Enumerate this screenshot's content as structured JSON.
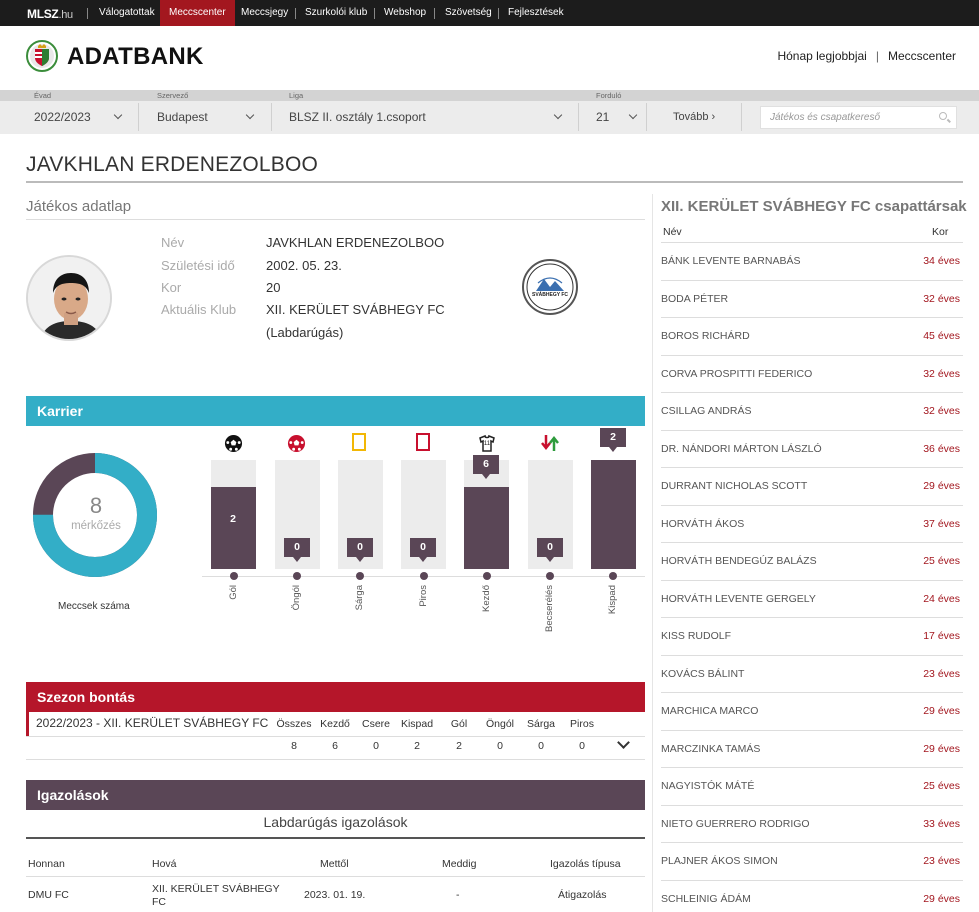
{
  "topnav": {
    "logo_main": "MLSZ",
    "logo_suffix": ".hu",
    "items": [
      "Válogatottak",
      "Meccscenter",
      "Meccsjegy",
      "Szurkolói klub",
      "Webshop",
      "Szövetség",
      "Fejlesztések"
    ],
    "active": "Meccscenter"
  },
  "header": {
    "brand": "ADATBANK",
    "links": [
      "Hónap legjobbjai",
      "Meccscenter"
    ]
  },
  "filters": {
    "season_label": "Évad",
    "season_value": "2022/2023",
    "organizer_label": "Szervező",
    "organizer_value": "Budapest",
    "league_label": "Liga",
    "league_value": "BLSZ II. osztály 1.csoport",
    "round_label": "Forduló",
    "round_value": "21",
    "next_label": "Tovább",
    "search_placeholder": "Játékos és csapatkereső"
  },
  "player": {
    "name": "JAVKHLAN ERDENEZOLBOO",
    "section_title": "Játékos adatlap",
    "fields": [
      {
        "label": "Név",
        "value": "JAVKHLAN ERDENEZOLBOO"
      },
      {
        "label": "Születési idő",
        "value": "2002. 05. 23."
      },
      {
        "label": "Kor",
        "value": "20"
      },
      {
        "label": "Aktuális Klub",
        "value": "XII. KERÜLET SVÁBHEGY FC"
      }
    ],
    "club_sport": "(Labdarúgás)",
    "club_logo_text": "SVÁBHEGY FC"
  },
  "career": {
    "title": "Karrier",
    "matches_count": "8",
    "matches_unit": "mérkőzés",
    "donut_caption": "Meccsek száma",
    "donut_fraction": 0.75,
    "stats": [
      {
        "label": "Gól",
        "value": 2,
        "icon": "ball-icon"
      },
      {
        "label": "Öngól",
        "value": 0,
        "icon": "own-goal-ball-icon"
      },
      {
        "label": "Sárga",
        "value": 0,
        "icon": "yellow-card-icon"
      },
      {
        "label": "Piros",
        "value": 0,
        "icon": "red-card-icon"
      },
      {
        "label": "Kezdő",
        "value": 6,
        "icon": "starting-jersey-icon"
      },
      {
        "label": "Becserélés",
        "value": 0,
        "icon": "substitution-arrows-icon"
      },
      {
        "label": "Kispad",
        "value": 2,
        "icon": "bench-icon"
      }
    ],
    "colors": {
      "accent": "#33aec7",
      "bar": "#5a4656",
      "goal_icon": "#111111",
      "owngoal_icon": "#c8102e",
      "yellow": "#f2b705",
      "red": "#c8102e"
    }
  },
  "season": {
    "title": "Szezon bontás",
    "name": "2022/2023 - XII. KERÜLET SVÁBHEGY FC",
    "headers": [
      "Összes",
      "Kezdő",
      "Csere",
      "Kispad",
      "Gól",
      "Öngól",
      "Sárga",
      "Piros"
    ],
    "values": [
      "8",
      "6",
      "0",
      "2",
      "2",
      "0",
      "0",
      "0"
    ]
  },
  "registrations": {
    "title": "Igazolások",
    "subtitle": "Labdarúgás igazolások",
    "headers": [
      "Honnan",
      "Hová",
      "Mettől",
      "Meddig",
      "Igazolás típusa"
    ],
    "rows": [
      {
        "from": "DMU FC",
        "to": "XII. KERÜLET SVÁBHEGY FC",
        "since": "2023. 01. 19.",
        "until": "-",
        "type": "Átigazolás"
      }
    ]
  },
  "teammates": {
    "title": "XII. KERÜLET SVÁBHEGY FC csapattársak",
    "col_name": "Név",
    "col_age": "Kor",
    "list": [
      {
        "name": "BÁNK LEVENTE BARNABÁS",
        "age": "34 éves"
      },
      {
        "name": "BODA PÉTER",
        "age": "32 éves"
      },
      {
        "name": "BOROS RICHÁRD",
        "age": "45 éves"
      },
      {
        "name": "CORVA PROSPITTI FEDERICO",
        "age": "32 éves"
      },
      {
        "name": "CSILLAG ANDRÁS",
        "age": "32 éves"
      },
      {
        "name": "DR. NÁNDORI MÁRTON LÁSZLÓ",
        "age": "36 éves"
      },
      {
        "name": "DURRANT NICHOLAS SCOTT",
        "age": "29 éves"
      },
      {
        "name": "HORVÁTH ÁKOS",
        "age": "37 éves"
      },
      {
        "name": "HORVÁTH BENDEGÚZ BALÁZS",
        "age": "25 éves"
      },
      {
        "name": "HORVÁTH LEVENTE GERGELY",
        "age": "24 éves"
      },
      {
        "name": "KISS RUDOLF",
        "age": "17 éves"
      },
      {
        "name": "KOVÁCS BÁLINT",
        "age": "23 éves"
      },
      {
        "name": "MARCHICA MARCO",
        "age": "29 éves"
      },
      {
        "name": "MARCZINKA TAMÁS",
        "age": "29 éves"
      },
      {
        "name": "NAGYISTÓK MÁTÉ",
        "age": "25 éves"
      },
      {
        "name": "NIETO GUERRERO RODRIGO",
        "age": "33 éves"
      },
      {
        "name": "PLAJNER ÁKOS SIMON",
        "age": "23 éves"
      },
      {
        "name": "SCHLEINIG ÁDÁM",
        "age": "29 éves"
      }
    ]
  }
}
